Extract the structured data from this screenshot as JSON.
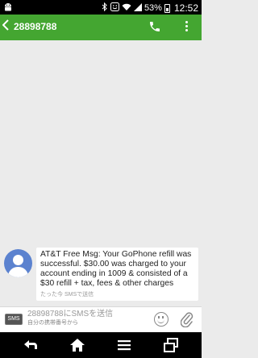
{
  "status_bar": {
    "notification_icon": "android-head-icon",
    "icons": [
      "bluetooth-icon",
      "smile-icon",
      "wifi-icon",
      "signal-icon"
    ],
    "battery": "53%",
    "time": "12:52"
  },
  "app_bar": {
    "title": "28898788",
    "background": "#44a631",
    "actions": [
      "phone-icon",
      "overflow-menu-icon"
    ]
  },
  "message": {
    "text": "AT&T Free Msg: Your GoPhone refill was successful. $30.00 was charged to your account ending in 1009 & consisted of a $30 refill + tax, fees & other charges",
    "meta": "たった今 SMSで送信"
  },
  "compose": {
    "badge": "SMS",
    "placeholder": "28898788にSMSを送信",
    "subtext": "自分の携帯番号から"
  },
  "nav_bar": {
    "buttons": [
      "back-icon",
      "home-icon",
      "menu-icon",
      "recent-apps-icon"
    ]
  }
}
